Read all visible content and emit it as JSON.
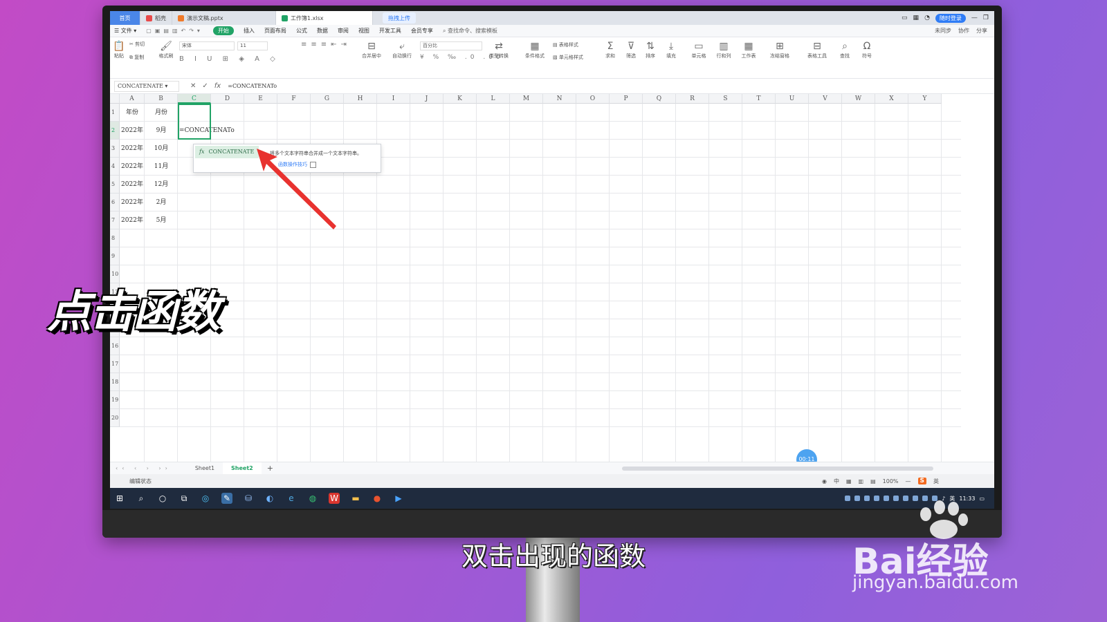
{
  "tabs": [
    {
      "label": "首页",
      "kind": "home"
    },
    {
      "label": "稻壳",
      "color": "#e84a4a"
    },
    {
      "label": "演示文稿.pptx",
      "color": "#f07a2a"
    },
    {
      "label": "工作簿1.xlsx",
      "color": "#21a366",
      "active": true
    }
  ],
  "tab_right": {
    "upload": "拖拽上传",
    "login": "随时登录"
  },
  "menu": {
    "file": "文件",
    "items": [
      "开始",
      "插入",
      "页面布局",
      "公式",
      "数据",
      "审阅",
      "视图",
      "开发工具",
      "会员专享"
    ],
    "search": "查找命令、搜索模板",
    "right": [
      "未同步",
      "协作",
      "分享"
    ]
  },
  "toolbar": {
    "paste": "粘贴",
    "cut": "剪切",
    "copy": "复制",
    "format_painter": "格式刷",
    "font": "宋体",
    "size": "11",
    "merge": "合并居中",
    "wrap": "自动换行",
    "number_format": "百分比",
    "type_convert": "类型转换",
    "cond_format": "条件格式",
    "table_style": "表格样式",
    "cell_style": "单元格样式",
    "sum": "求和",
    "filter": "筛选",
    "sort": "排序",
    "fill": "填充",
    "cell": "单元格",
    "row_col": "行和列",
    "worksheet": "工作表",
    "freeze": "冻结窗格",
    "table_tools": "表格工具",
    "find": "查找",
    "symbol": "符号"
  },
  "formula_bar": {
    "name_box": "CONCATENATE",
    "fx": "fx",
    "content": "=CONCATENATo"
  },
  "columns": [
    "A",
    "B",
    "C",
    "D",
    "E",
    "F",
    "G",
    "H",
    "I",
    "J",
    "K",
    "L",
    "M",
    "N",
    "O",
    "P",
    "Q",
    "R",
    "S",
    "T",
    "U",
    "V",
    "W",
    "X",
    "Y"
  ],
  "rows_visible": [
    "1",
    "2",
    "3",
    "4",
    "5",
    "6",
    "7",
    "8",
    "9",
    "10",
    "13",
    "14",
    "15",
    "16",
    "17",
    "18",
    "19",
    "20"
  ],
  "cells": {
    "A1": "年份",
    "B1": "月份",
    "A2": "2022年",
    "B2": "9月",
    "C2": "=CONCATENATo",
    "A3": "2022年",
    "B3": "10月",
    "A4": "2022年",
    "B4": "11月",
    "A5": "2022年",
    "B5": "12月",
    "A6": "2022年",
    "B6": "2月",
    "A7": "2022年",
    "B7": "5月"
  },
  "autocomplete": {
    "item": "CONCATENATE",
    "fx": "fx",
    "description": "将多个文本字符串合并成一个文本字符串。",
    "link": "函数操作技巧"
  },
  "sheets": [
    "Sheet1",
    "Sheet2"
  ],
  "active_sheet": "Sheet2",
  "add_sheet": "+",
  "status": {
    "mode": "编辑状态",
    "zoom": "100%",
    "ime": "英",
    "ime_center": "中",
    "tray_lang": "英"
  },
  "clock": {
    "time": "11:33"
  },
  "timer": "00:11",
  "overlay_text": "点击函数",
  "subtitle": "双击出现的函数",
  "watermark": {
    "brand": "Bai经验",
    "url": "jingyan.baidu.com"
  },
  "colors": {
    "accent": "#21a366",
    "highlight_arrow": "#e8322f",
    "home_tab": "#4a86e8",
    "taskbar": "#1f2b3e"
  }
}
